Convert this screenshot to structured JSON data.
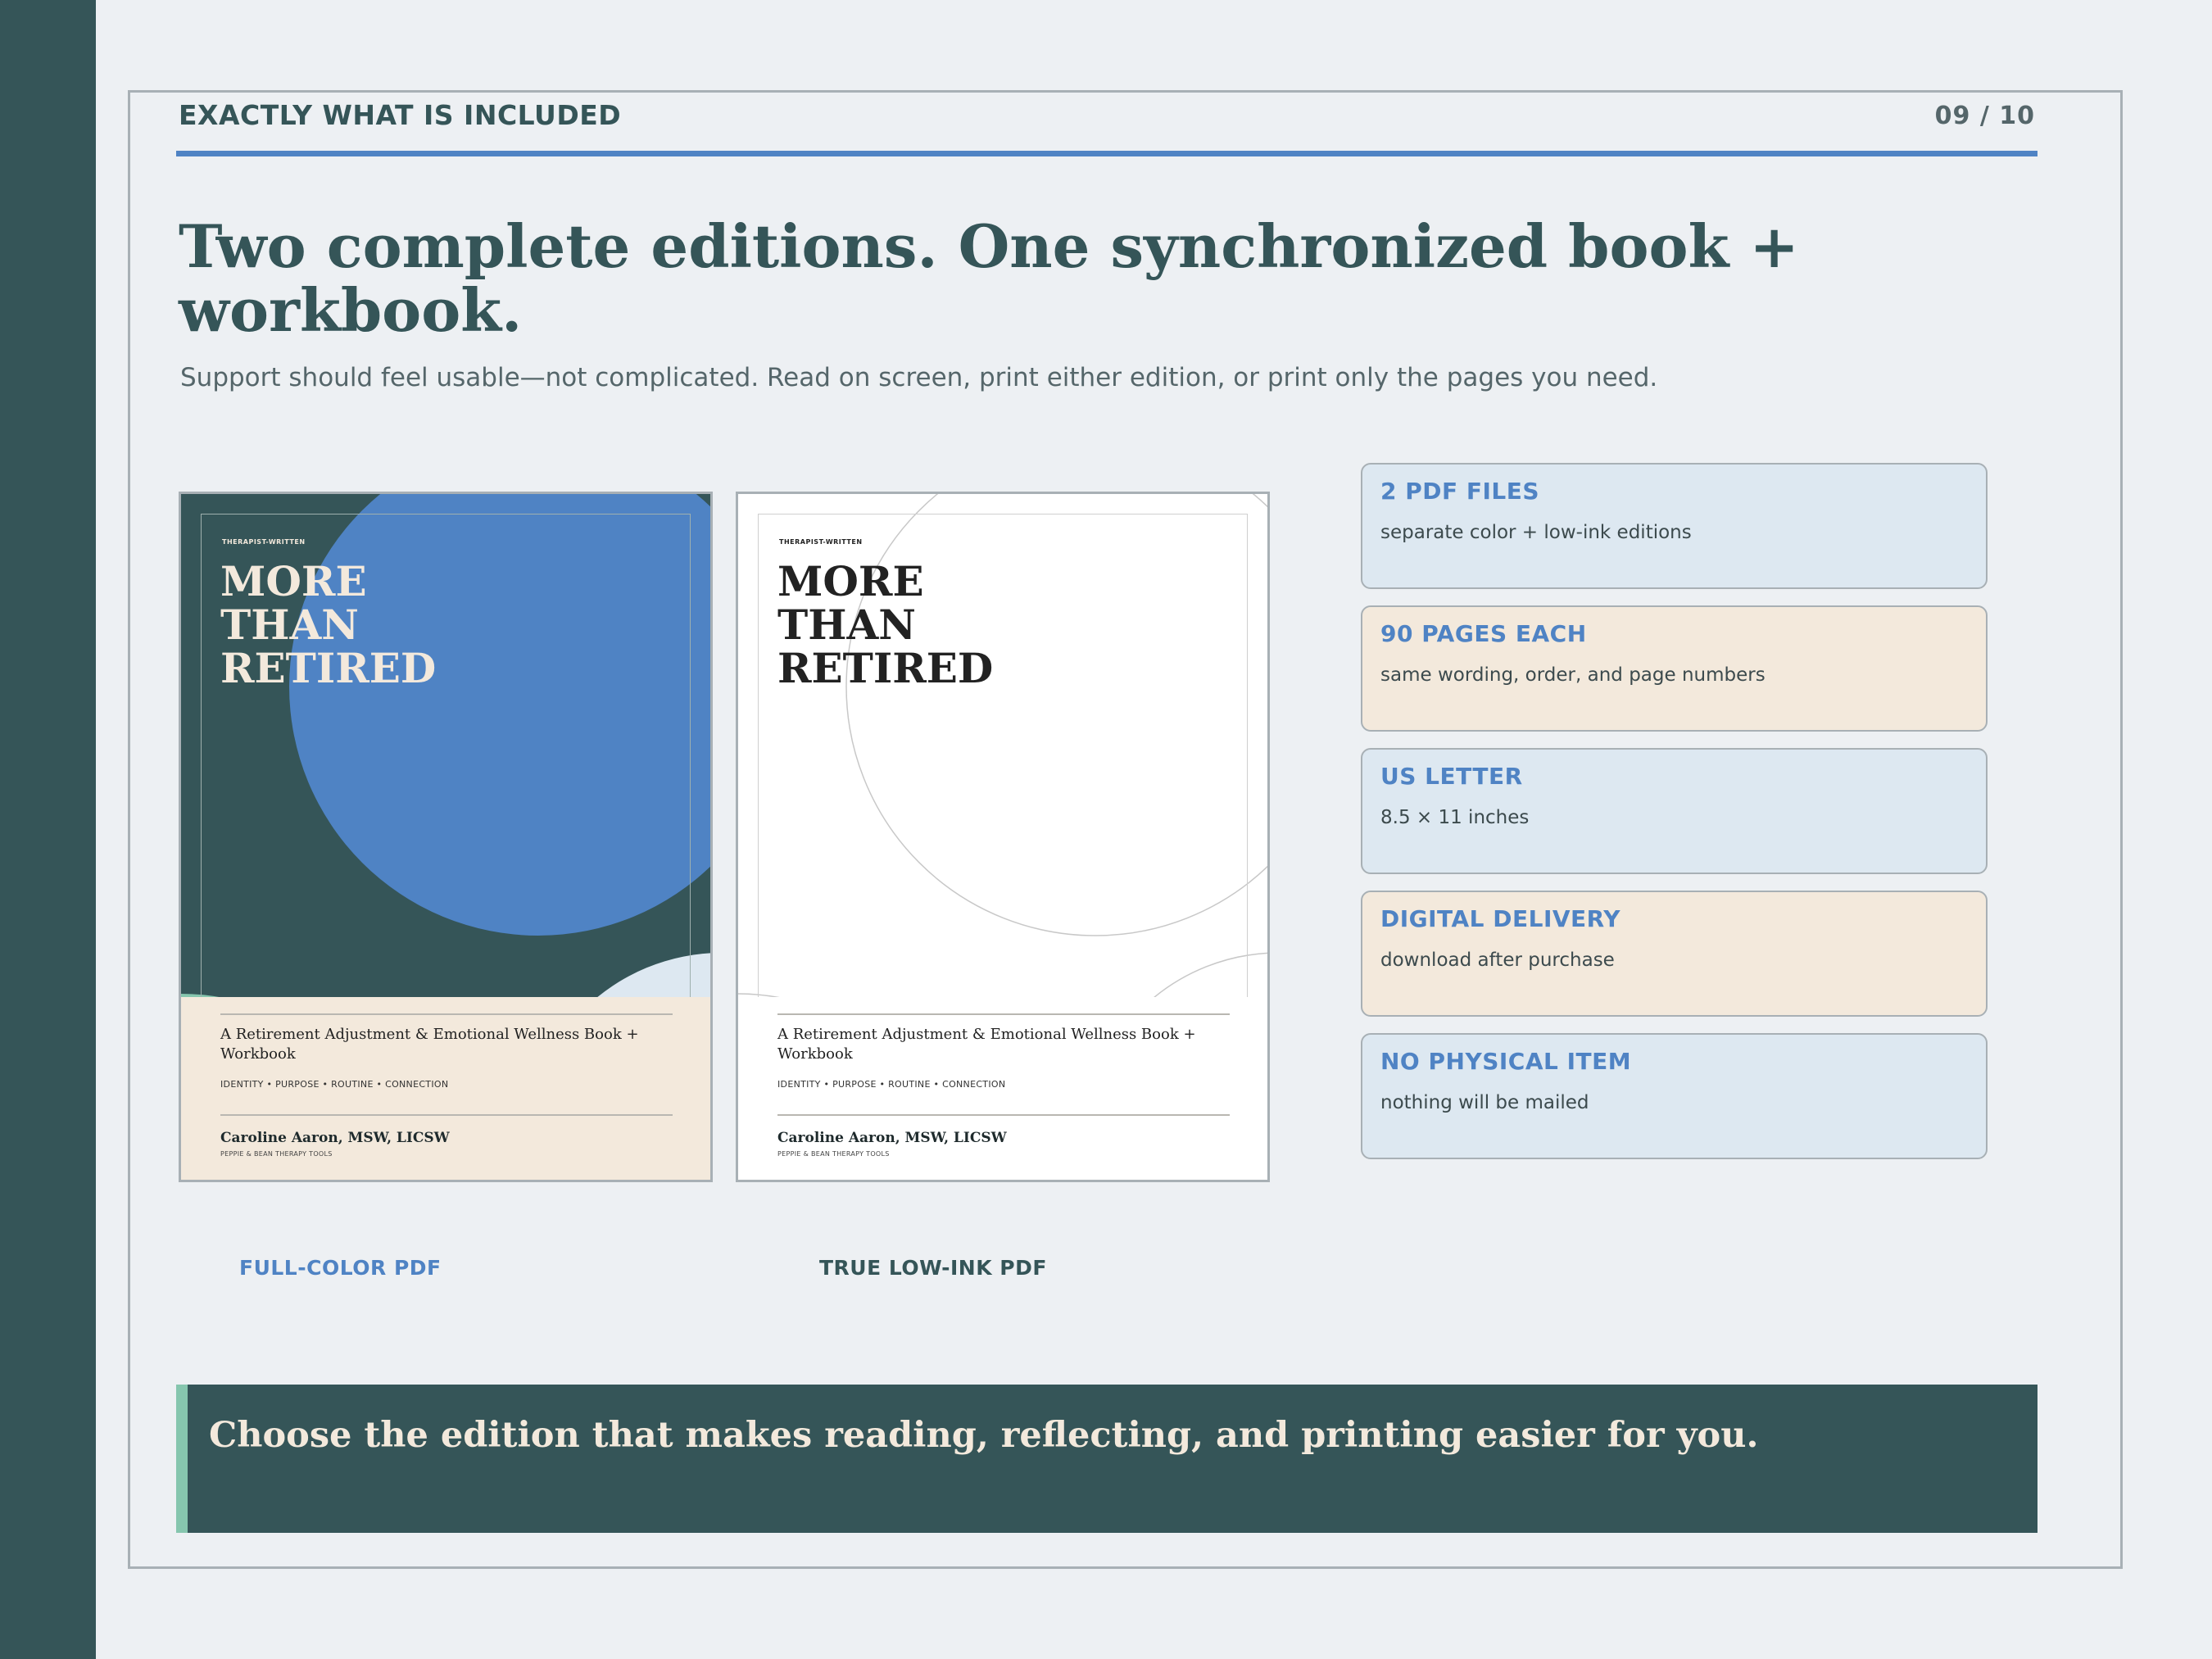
{
  "header": {
    "kicker": "EXACTLY WHAT IS INCLUDED",
    "page_number": "09 / 10"
  },
  "title": "Two complete editions. One synchronized book + workbook.",
  "subtitle": "Support should feel usable—not complicated. Read on screen, print either edition, or print only the pages you need.",
  "covers": [
    {
      "edition": "color",
      "tag": "THERAPIST-WRITTEN",
      "title_lines": [
        "MORE",
        "THAN",
        "RETIRED"
      ],
      "description": "A Retirement Adjustment & Emotional Wellness Book + Workbook",
      "themes": "IDENTITY  •  PURPOSE  •  ROUTINE  •  CONNECTION",
      "author": "Caroline Aaron, MSW, LICSW",
      "publisher": "PEPPIE & BEAN THERAPY TOOLS",
      "label": "FULL-COLOR PDF"
    },
    {
      "edition": "low-ink",
      "tag": "THERAPIST-WRITTEN",
      "title_lines": [
        "MORE",
        "THAN",
        "RETIRED"
      ],
      "description": "A Retirement Adjustment & Emotional Wellness Book + Workbook",
      "themes": "IDENTITY  •  PURPOSE  •  ROUTINE  •  CONNECTION",
      "author": "Caroline Aaron, MSW, LICSW",
      "publisher": "PEPPIE & BEAN THERAPY TOOLS",
      "label": "TRUE LOW-INK PDF"
    }
  ],
  "specs": [
    {
      "title": "2 PDF FILES",
      "desc": "separate color + low-ink editions"
    },
    {
      "title": "90 PAGES EACH",
      "desc": "same wording, order, and page numbers"
    },
    {
      "title": "US LETTER",
      "desc": "8.5 × 11 inches"
    },
    {
      "title": "DIGITAL DELIVERY",
      "desc": "download after purchase"
    },
    {
      "title": "NO PHYSICAL ITEM",
      "desc": "nothing will be mailed"
    }
  ],
  "banner": "Choose the edition that makes reading, reflecting, and printing easier for you.",
  "colors": {
    "teal": "#355558",
    "accent_blue": "#4f83c4",
    "mint": "#86c6ae",
    "sand": "#f3e9dc",
    "pale_blue": "#dde8f1",
    "background": "#edf0f3"
  }
}
